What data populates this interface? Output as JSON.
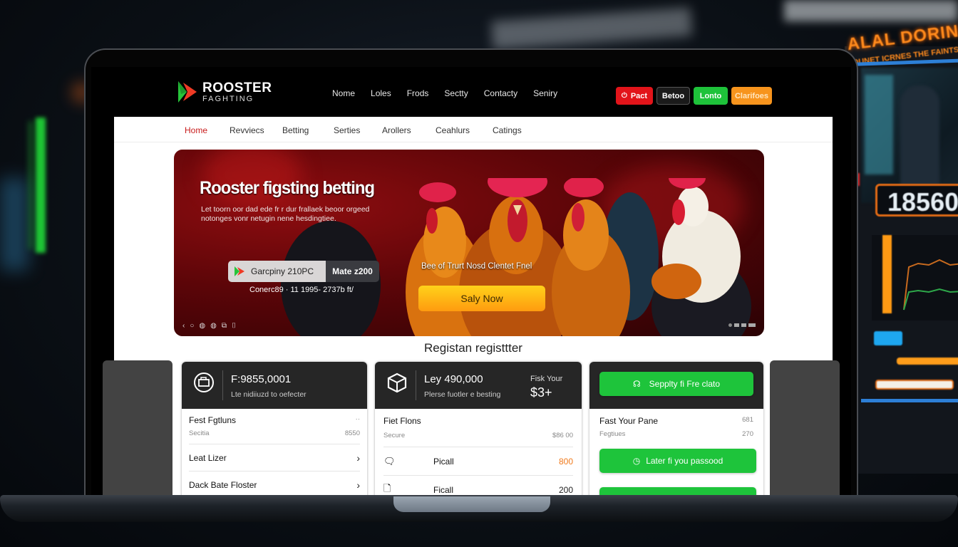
{
  "background": {
    "right_monitor": {
      "title": "ALAL DORING S",
      "subtitle": "DUNET ICRNES THE FAINTS",
      "counter": "18560"
    }
  },
  "site": {
    "brand": {
      "name": "ROOSTER",
      "sub": "FAGHTING",
      "colors": {
        "green": "#27c43a",
        "red": "#ef3a24"
      }
    },
    "top_nav": [
      "Nome",
      "Loles",
      "Frods",
      "Sectty",
      "Contacty",
      "Seniry"
    ],
    "top_buttons": [
      {
        "label": "Pact",
        "icon": "power-icon",
        "color": "#e2141a"
      },
      {
        "label": "Betoo",
        "color": "#1a1a1a"
      },
      {
        "label": "Lonto",
        "color": "#1ec23a"
      },
      {
        "label": "Clarifoes",
        "color": "#f7941d"
      }
    ],
    "sub_nav": {
      "active": "Home",
      "items": [
        "Home",
        "Revviecs",
        "Betting",
        "Serties",
        "Arollers",
        "Ceahlurs",
        "Catings"
      ]
    }
  },
  "hero": {
    "title": "Rooster figsting betting",
    "description": "Let toorn oor dad ede fr r dur frallaek beoor orgeed notonges vonr netugin nene hesdingtiee.",
    "pill": {
      "left_label": "Garcpiny 210PC",
      "right_label": "Mate z200"
    },
    "coords": "Conerc89 · 11 1995- 2737b ft/",
    "tagline": "Bee of Trurt Nosd Clentet Fnel",
    "cta_label": "Saly Now",
    "controls": [
      "‹",
      "○",
      "◍",
      "◍",
      "⧉",
      "⌷"
    ]
  },
  "register": {
    "title": "Registan registtter",
    "cards": [
      {
        "icon": "wallet-icon",
        "amount": "F:9855,0001",
        "subtitle": "Lte nidiiuzd to oefecter",
        "header_row": {
          "title": "Fest Fgtluns",
          "meta_left": "Secitia",
          "meta_right_top": "··",
          "meta_right": "8550"
        },
        "rows": [
          {
            "title": "Leat Lizer"
          },
          {
            "title": "Dack Bate Floster"
          }
        ]
      },
      {
        "icon": "box-icon",
        "amount": "Ley 490,000",
        "subtitle": "Plerse fuotler e besting",
        "aside_label": "Fisk Your",
        "aside_value": "$3+",
        "header_row": {
          "title": "Fiet Flons",
          "meta_left": "Secure",
          "meta_right": "$86 00"
        },
        "rows": [
          {
            "icon": "chat-icon",
            "title": "Picall",
            "value": "800",
            "value_color": "#f07a1c"
          },
          {
            "icon": "document-icon",
            "title": "Ficall",
            "value": "200",
            "value_color": "#222222"
          }
        ]
      },
      {
        "top_button": {
          "label": "Sepplty fi Fre clato",
          "icon": "headset-icon"
        },
        "header_row": {
          "title": "Fast Your Pane",
          "meta_left": "Fegtiues",
          "meta_right_top": "681",
          "meta_right": "270"
        },
        "buttons": [
          {
            "label": "Later fi you passood",
            "icon": "clock-icon"
          },
          {
            "label": ""
          }
        ]
      }
    ]
  }
}
